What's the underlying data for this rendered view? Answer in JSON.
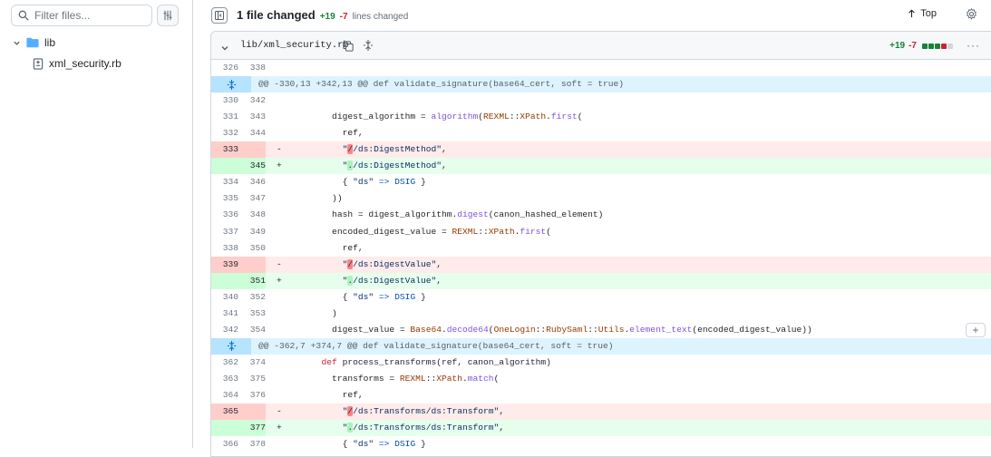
{
  "app": {
    "title": "1 file changed"
  },
  "sidebar": {
    "filter_placeholder": "Filter files...",
    "tree": [
      {
        "type": "directory",
        "label": "lib",
        "expanded": true
      },
      {
        "type": "file",
        "label": "xml_security.rb"
      }
    ]
  },
  "header": {
    "files_changed": "1 file changed",
    "additions": "+19",
    "deletions": "-7",
    "lines_changed": "lines changed",
    "top_label": "Top"
  },
  "file": {
    "path": "lib/xml_security.rb",
    "additions": "+19",
    "deletions": "-7",
    "blocks": [
      "#1a7f37",
      "#1a7f37",
      "#1a7f37",
      "#cf222e",
      "#d0d7de"
    ]
  },
  "colors": {
    "add_bg": "#e6ffec",
    "del_bg": "#ffebe9",
    "hunk_bg": "#ddf4ff",
    "accent": "#0969da"
  },
  "diff": [
    {
      "type": "ctx",
      "old": "326",
      "new": "338",
      "text": ""
    },
    {
      "type": "hunk",
      "text": "@@ -330,13 +342,13 @@ def validate_signature(base64_cert, soft = true)"
    },
    {
      "type": "ctx",
      "old": "330",
      "new": "342",
      "text": ""
    },
    {
      "type": "ctx",
      "old": "331",
      "new": "343",
      "text": "        digest_algorithm = algorithm(REXML::XPath.first("
    },
    {
      "type": "ctx",
      "old": "332",
      "new": "344",
      "text": "          ref,"
    },
    {
      "type": "del",
      "old": "333",
      "new": "",
      "sign": "-",
      "text": "          \"//ds:DigestMethod\","
    },
    {
      "type": "add",
      "old": "",
      "new": "345",
      "sign": "+",
      "text": "          \"./ds:DigestMethod\","
    },
    {
      "type": "ctx",
      "old": "334",
      "new": "346",
      "text": "          { \"ds\" => DSIG }"
    },
    {
      "type": "ctx",
      "old": "335",
      "new": "347",
      "text": "        ))"
    },
    {
      "type": "ctx",
      "old": "336",
      "new": "348",
      "text": "        hash = digest_algorithm.digest(canon_hashed_element)"
    },
    {
      "type": "ctx",
      "old": "337",
      "new": "349",
      "text": "        encoded_digest_value = REXML::XPath.first("
    },
    {
      "type": "ctx",
      "old": "338",
      "new": "350",
      "text": "          ref,"
    },
    {
      "type": "del",
      "old": "339",
      "new": "",
      "sign": "-",
      "text": "          \"//ds:DigestValue\","
    },
    {
      "type": "add",
      "old": "",
      "new": "351",
      "sign": "+",
      "text": "          \"./ds:DigestValue\","
    },
    {
      "type": "ctx",
      "old": "340",
      "new": "352",
      "text": "          { \"ds\" => DSIG }"
    },
    {
      "type": "ctx",
      "old": "341",
      "new": "353",
      "text": "        )"
    },
    {
      "type": "ctx",
      "old": "342",
      "new": "354",
      "text": "        digest_value = Base64.decode64(OneLogin::RubySaml::Utils.element_text(encoded_digest_value))"
    },
    {
      "type": "hunk",
      "text": "@@ -362,7 +374,7 @@ def validate_signature(base64_cert, soft = true)"
    },
    {
      "type": "ctx",
      "old": "362",
      "new": "374",
      "text": "      def process_transforms(ref, canon_algorithm)"
    },
    {
      "type": "ctx",
      "old": "363",
      "new": "375",
      "text": "        transforms = REXML::XPath.match("
    },
    {
      "type": "ctx",
      "old": "364",
      "new": "376",
      "text": "          ref,"
    },
    {
      "type": "del",
      "old": "365",
      "new": "",
      "sign": "-",
      "text": "          \"//ds:Transforms/ds:Transform\","
    },
    {
      "type": "add",
      "old": "",
      "new": "377",
      "sign": "+",
      "text": "          \"./ds:Transforms/ds:Transform\","
    },
    {
      "type": "ctx",
      "old": "366",
      "new": "378",
      "text": "          { \"ds\" => DSIG }"
    }
  ]
}
